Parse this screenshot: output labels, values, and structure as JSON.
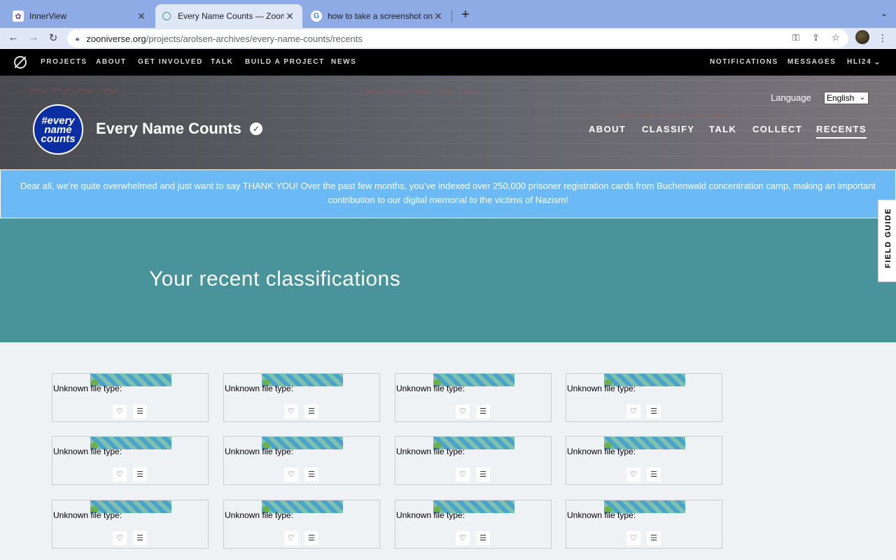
{
  "browser": {
    "tabs": [
      {
        "title": "InnerView",
        "icon": "innerview-icon"
      },
      {
        "title": "Every Name Counts — Zooniverse",
        "icon": "zooniverse-icon"
      },
      {
        "title": "how to take a screenshot on m",
        "icon": "google-icon"
      }
    ],
    "url_host": "zooniverse.org",
    "url_path": "/projects/arolsen-archives/every-name-counts/recents"
  },
  "site_nav": {
    "items": [
      "PROJECTS",
      "ABOUT",
      "GET INVOLVED",
      "TALK",
      "BUILD A PROJECT",
      "NEWS"
    ],
    "right": [
      "NOTIFICATIONS",
      "MESSAGES",
      "HLI24"
    ]
  },
  "project": {
    "avatar_text_1": "#every",
    "avatar_text_2": "name",
    "avatar_text_3": "counts",
    "title": "Every Name Counts",
    "language_label": "Language",
    "language_value": "English",
    "nav": [
      "ABOUT",
      "CLASSIFY",
      "TALK",
      "COLLECT",
      "RECENTS"
    ]
  },
  "banner": {
    "text": "Dear all, we’re quite overwhelmed and just want to say THANK YOU! Over the past few months, you’ve indexed over 250,000 prisoner registration cards from Buchenwald concentration camp, making an important contribution to our digital memorial to the victims of Nazism!"
  },
  "recents": {
    "title": "Your recent classifications",
    "field_guide": "FIELD GUIDE",
    "card_label": "Unknown file type:"
  },
  "colors": {
    "banner": "#6cbaf5",
    "recents_bg": "#48949a",
    "avatar": "#0b2fa3"
  }
}
